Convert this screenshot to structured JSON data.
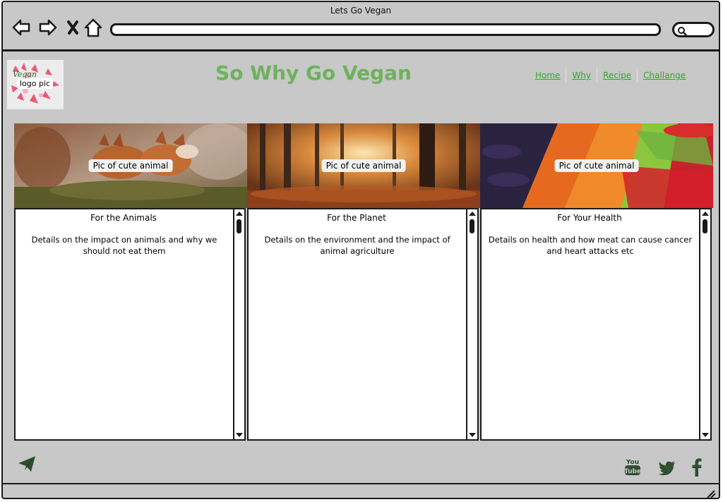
{
  "browser": {
    "title": "Lets Go Vegan",
    "url": "",
    "search_icon": "search-icon"
  },
  "header": {
    "logo_label": "logo pic",
    "logo_script_text": "Vegan",
    "title": "So Why Go Vegan"
  },
  "nav": {
    "items": [
      {
        "label": "Home"
      },
      {
        "label": "Why"
      },
      {
        "label": "Recipe"
      },
      {
        "label": "Challange"
      }
    ]
  },
  "columns": [
    {
      "image_label": "Pic of cute animal",
      "heading": "For the Animals",
      "body": "Details on the impact on animals and why we should not eat them"
    },
    {
      "image_label": "Pic of cute animal",
      "heading": "For the Planet",
      "body": "Details on the environment and the impact of animal agriculture"
    },
    {
      "image_label": "Pic of cute animal",
      "heading": "For Your Health",
      "body": "Details on health and how meat can cause cancer and heart attacks etc"
    }
  ],
  "footer": {
    "left_icon": "paper-plane-icon",
    "social": [
      {
        "icon": "youtube-icon"
      },
      {
        "icon": "twitter-icon"
      },
      {
        "icon": "facebook-icon"
      }
    ]
  },
  "colors": {
    "window_bg": "#c8c8c8",
    "title_green": "#6db35b",
    "link_green": "#2ea82e",
    "icon_dark_green": "#2f4f2f"
  }
}
